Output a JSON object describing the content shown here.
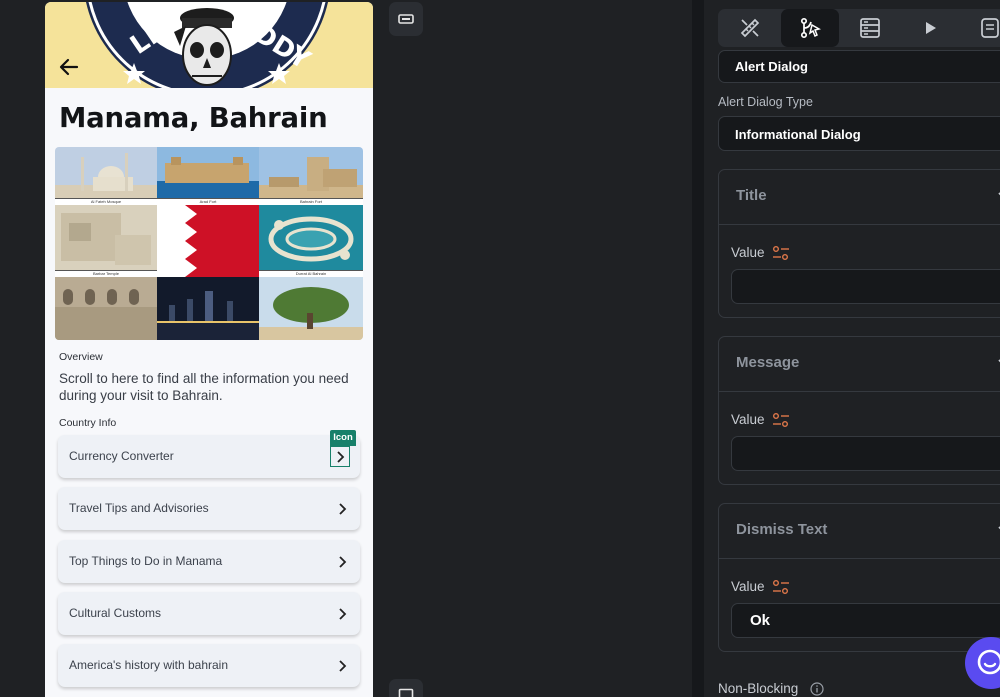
{
  "preview": {
    "badge_text": "LIBERTY BUDDY",
    "city_title": "Manama, Bahrain",
    "gallery": [
      {
        "name": "mosque",
        "caption": "Al Fateh Mosque"
      },
      {
        "name": "fort-sea",
        "caption": "Arad Fort"
      },
      {
        "name": "fort-ruins",
        "caption": "Bahrain Fort"
      },
      {
        "name": "stone-ruins",
        "caption": "Barbar Temple"
      },
      {
        "name": "flag",
        "caption": ""
      },
      {
        "name": "island-aerial",
        "caption": "Durrat Al Bahrain"
      },
      {
        "name": "arches",
        "caption": ""
      },
      {
        "name": "night-skyline",
        "caption": ""
      },
      {
        "name": "tree",
        "caption": ""
      }
    ],
    "overview_label": "Overview",
    "overview_text": "Scroll to here to find all the information you need during your visit to Bahrain.",
    "country_info_label": "Country Info",
    "icon_tag": "Icon",
    "cards": [
      {
        "label": "Currency Converter"
      },
      {
        "label": "Travel Tips and Advisories"
      },
      {
        "label": "Top Things to Do in Manama"
      },
      {
        "label": "Cultural Customs"
      },
      {
        "label": "America's history with bahrain"
      }
    ]
  },
  "panel": {
    "tabs": [
      {
        "icon": "ruler-pencil-icon",
        "active": false
      },
      {
        "icon": "actions-branch-icon",
        "active": true
      },
      {
        "icon": "database-icon",
        "active": false
      },
      {
        "icon": "play-icon",
        "active": false
      },
      {
        "icon": "page-icon",
        "active": false
      }
    ],
    "widget_dropdown": "Alert Dialog",
    "dialog_type_label": "Alert Dialog Type",
    "dialog_type_value": "Informational Dialog",
    "sections": {
      "title": {
        "heading": "Title",
        "value_label": "Value",
        "value": ""
      },
      "message": {
        "heading": "Message",
        "value_label": "Value",
        "value": ""
      },
      "dismiss": {
        "heading": "Dismiss Text",
        "value_label": "Value",
        "value": "Ok"
      }
    },
    "non_blocking_label": "Non-Blocking"
  },
  "colors": {
    "accent_orange": "#e0784a",
    "tag_green": "#17806a",
    "flag_red": "#ce1126",
    "fab_purple": "#5a4bf0"
  }
}
